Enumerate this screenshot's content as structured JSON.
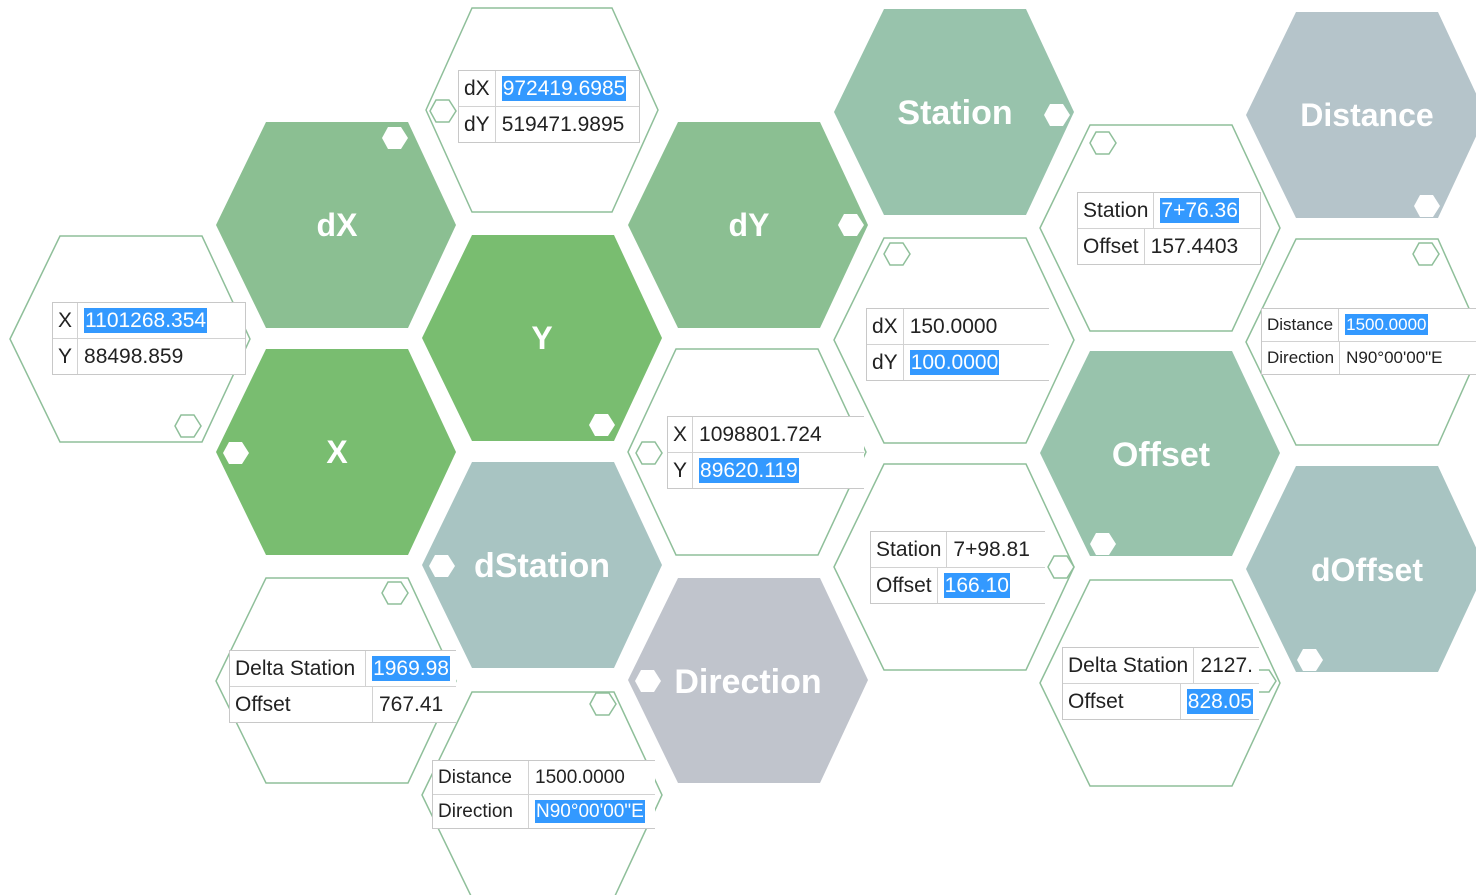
{
  "colors": {
    "green_bright": "#79bd70",
    "green_mid": "#8bbf92",
    "green_sage": "#98c3ac",
    "teal_gray": "#a8c4c2",
    "blue_gray": "#b5c4ca",
    "gray": "#c0c4cc",
    "outline": "#8fbf9a",
    "selection": "#3399ff"
  },
  "labels": {
    "dx": "dX",
    "dy": "dY",
    "y": "Y",
    "x": "X",
    "dstation": "dStation",
    "direction": "Direction",
    "station": "Station",
    "offset": "Offset",
    "distance": "Distance",
    "doffset": "dOffset"
  },
  "cards": {
    "dxdy_top": {
      "rows": [
        {
          "label": "dX",
          "value": "972419.6985",
          "selected": true
        },
        {
          "label": "dY",
          "value": "519471.9895",
          "selected": false
        }
      ]
    },
    "xy_left": {
      "rows": [
        {
          "label": "X",
          "value": "1101268.354",
          "selected": true
        },
        {
          "label": "Y",
          "value": "88498.859",
          "selected": false
        }
      ]
    },
    "station_offset_top": {
      "rows": [
        {
          "label": "Station",
          "value": "7+76.36",
          "selected": true
        },
        {
          "label": "Offset",
          "value": "157.4403",
          "selected": false
        }
      ]
    },
    "distance_direction_right": {
      "rows": [
        {
          "label": "Distance",
          "value": "1500.0000",
          "selected": true
        },
        {
          "label": "Direction",
          "value": "N90°00'00\"E",
          "selected": false
        }
      ]
    },
    "dxdy_mid": {
      "rows": [
        {
          "label": "dX",
          "value": "150.0000",
          "selected": false
        },
        {
          "label": "dY",
          "value": "100.0000",
          "selected": true
        }
      ]
    },
    "xy_mid": {
      "rows": [
        {
          "label": "X",
          "value": "1098801.724",
          "selected": false
        },
        {
          "label": "Y",
          "value": "89620.119",
          "selected": true
        }
      ]
    },
    "station_offset_mid": {
      "rows": [
        {
          "label": "Station",
          "value": "7+98.81",
          "selected": false
        },
        {
          "label": "Offset",
          "value": "166.10",
          "selected": true
        }
      ]
    },
    "delta_station_left": {
      "rows": [
        {
          "label": "Delta Station",
          "value": "1969.98",
          "selected": true
        },
        {
          "label": "Offset",
          "value": "767.41",
          "selected": false
        }
      ]
    },
    "distance_direction_bottom": {
      "rows": [
        {
          "label": "Distance",
          "value": "1500.0000",
          "selected": false
        },
        {
          "label": "Direction",
          "value": "N90°00'00\"E",
          "selected": true
        }
      ]
    },
    "delta_station_right": {
      "rows": [
        {
          "label": "Delta Station",
          "value": "2127.",
          "selected": false
        },
        {
          "label": "Offset",
          "value": "828.05",
          "selected": true
        }
      ]
    }
  }
}
